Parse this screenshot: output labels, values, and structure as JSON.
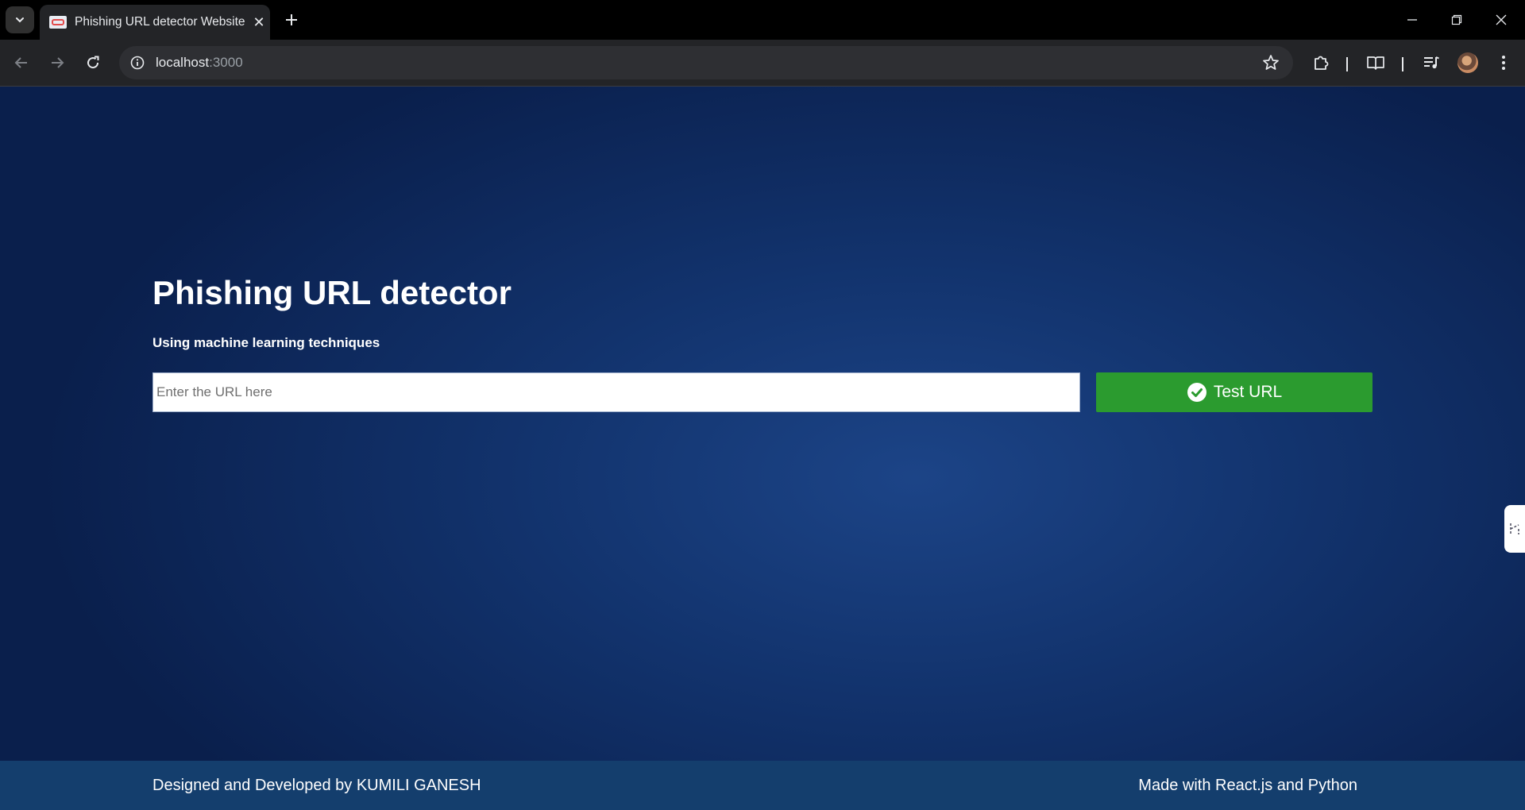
{
  "browser": {
    "tab_title": "Phishing URL detector Website",
    "url_host": "localhost",
    "url_port": ":3000"
  },
  "main": {
    "heading": "Phishing URL detector",
    "subheading": "Using machine learning techniques",
    "input_placeholder": "Enter the URL here",
    "input_value": "",
    "button_label": "Test URL",
    "button_color": "#2b9b2f"
  },
  "footer": {
    "left_text": "Designed and Developed by KUMILI GANESH",
    "right_text": "Made with React.js and Python"
  }
}
